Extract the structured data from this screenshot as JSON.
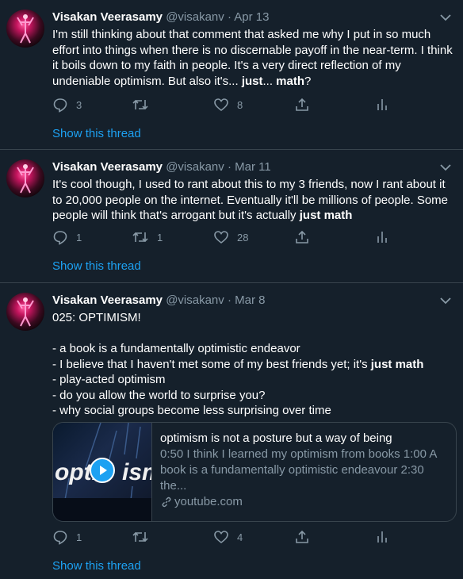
{
  "tweets": [
    {
      "name": "Visakan Veerasamy",
      "handle": "@visakanv",
      "separator": "·",
      "date": "Apr 13",
      "text": [
        {
          "t": "I'm still thinking about that comment that asked me why I put in so much effort into things when there is no discernable payoff in the near-term. I think it boils down to my faith in people. It's a very direct reflection of my undeniable optimism. But also it's... ",
          "b": false
        },
        {
          "t": "just",
          "b": true
        },
        {
          "t": "... ",
          "b": false
        },
        {
          "t": "math",
          "b": true
        },
        {
          "t": "?",
          "b": false
        }
      ],
      "reply_count": "3",
      "retweet_count": "",
      "like_count": "8",
      "show_thread": "Show this thread"
    },
    {
      "name": "Visakan Veerasamy",
      "handle": "@visakanv",
      "separator": "·",
      "date": "Mar 11",
      "text": [
        {
          "t": "It's cool though, I used to rant about this to my 3 friends, now I rant about it to 20,000 people on the internet. Eventually it'll be millions of people. Some people will think that's arrogant but it's actually ",
          "b": false
        },
        {
          "t": "just math",
          "b": true
        }
      ],
      "reply_count": "1",
      "retweet_count": "1",
      "like_count": "28",
      "show_thread": "Show this thread"
    },
    {
      "name": "Visakan Veerasamy",
      "handle": "@visakanv",
      "separator": "·",
      "date": "Mar 8",
      "lines": [
        [
          {
            "t": "025: OPTIMISM!",
            "b": false
          }
        ],
        [],
        [
          {
            "t": "- a book is a fundamentally optimistic endeavor",
            "b": false
          }
        ],
        [
          {
            "t": "- I believe that I haven't met some of my best friends yet; it's ",
            "b": false
          },
          {
            "t": "just math",
            "b": true
          }
        ],
        [
          {
            "t": "- play-acted optimism",
            "b": false
          }
        ],
        [
          {
            "t": "- do you allow the world to surprise you?",
            "b": false
          }
        ],
        [
          {
            "t": "- why social groups become less surprising over time",
            "b": false
          }
        ]
      ],
      "card": {
        "thumb_text": "opti",
        "thumb_text_2": "ism",
        "title": "optimism is not a posture but a way of being",
        "description": "0:50 I think I learned my optimism from books 1:00 A book is a fundamentally optimistic endeavour 2:30 the...",
        "domain": "youtube.com"
      },
      "reply_count": "1",
      "retweet_count": "",
      "like_count": "4",
      "show_thread": "Show this thread"
    }
  ],
  "colors": {
    "background": "#15202b",
    "muted": "#8899a6",
    "accent": "#1da1f2",
    "border": "#38444d"
  },
  "icons": [
    "avatar",
    "chevron-down-icon",
    "reply-icon",
    "retweet-icon",
    "like-icon",
    "share-icon",
    "analytics-icon",
    "play-icon",
    "link-icon"
  ]
}
